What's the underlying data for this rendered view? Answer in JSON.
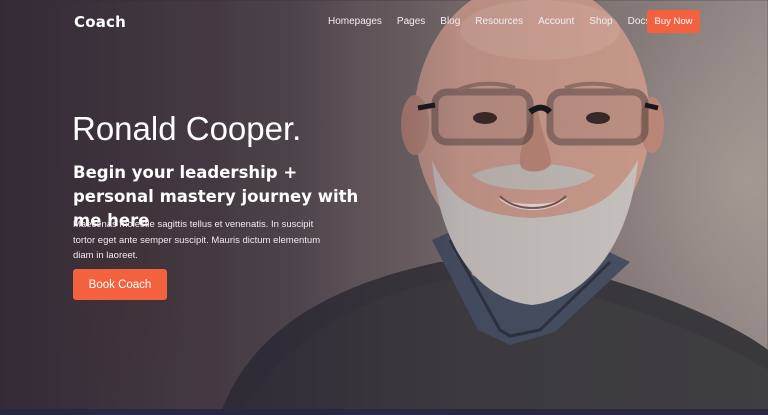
{
  "nav": {
    "logo": "Coach",
    "links": [
      "Homepages",
      "Pages",
      "Blog",
      "Resources",
      "Account",
      "Shop",
      "Docs"
    ],
    "cta_label": "Buy Now"
  },
  "hero": {
    "headline": "Ronald Cooper.",
    "subheadline": "Begin your leadership + personal mastery journey with me here",
    "body": "Maecenas molestie sagittis tellus et venenatis. In suscipit tortor eget ante semper suscipit. Mauris dictum elementum diam in laoreet.",
    "cta_label": "Book Coach"
  },
  "colors": {
    "accent": "#f4613f",
    "overlay": "#28223a",
    "text": "#ffffff"
  }
}
